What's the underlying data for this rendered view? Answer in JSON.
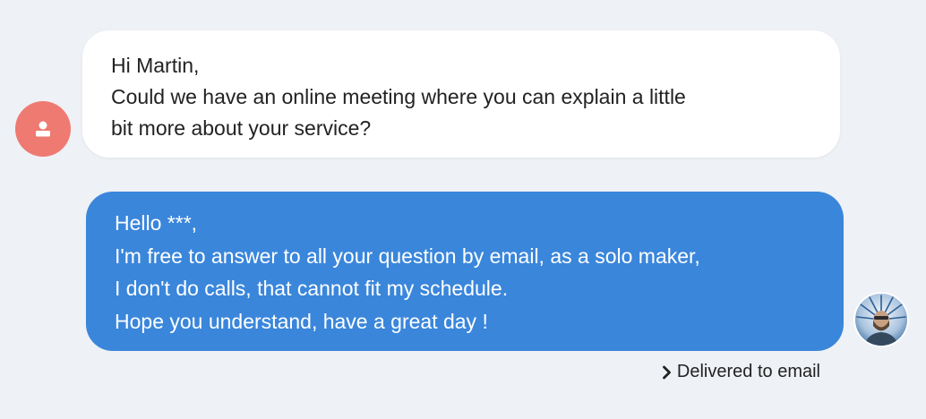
{
  "incoming_message": {
    "lines": [
      "Hi Martin,",
      "Could we have an online meeting where you can explain a little",
      "bit more about your service?"
    ],
    "avatar_icon": "user-icon",
    "avatar_color": "#ee7a72"
  },
  "outgoing_message": {
    "lines": [
      "Hello ***,",
      "I'm free to answer to all your question by email, as a solo maker,",
      "I don't do calls, that cannot fit my schedule.",
      "Hope you understand, have a great day !"
    ],
    "bubble_color": "#3a86db"
  },
  "status": {
    "icon": "chevron-right-icon",
    "label": "Delivered to email"
  },
  "colors": {
    "background": "#eef1f5",
    "incoming_bubble": "#ffffff"
  }
}
